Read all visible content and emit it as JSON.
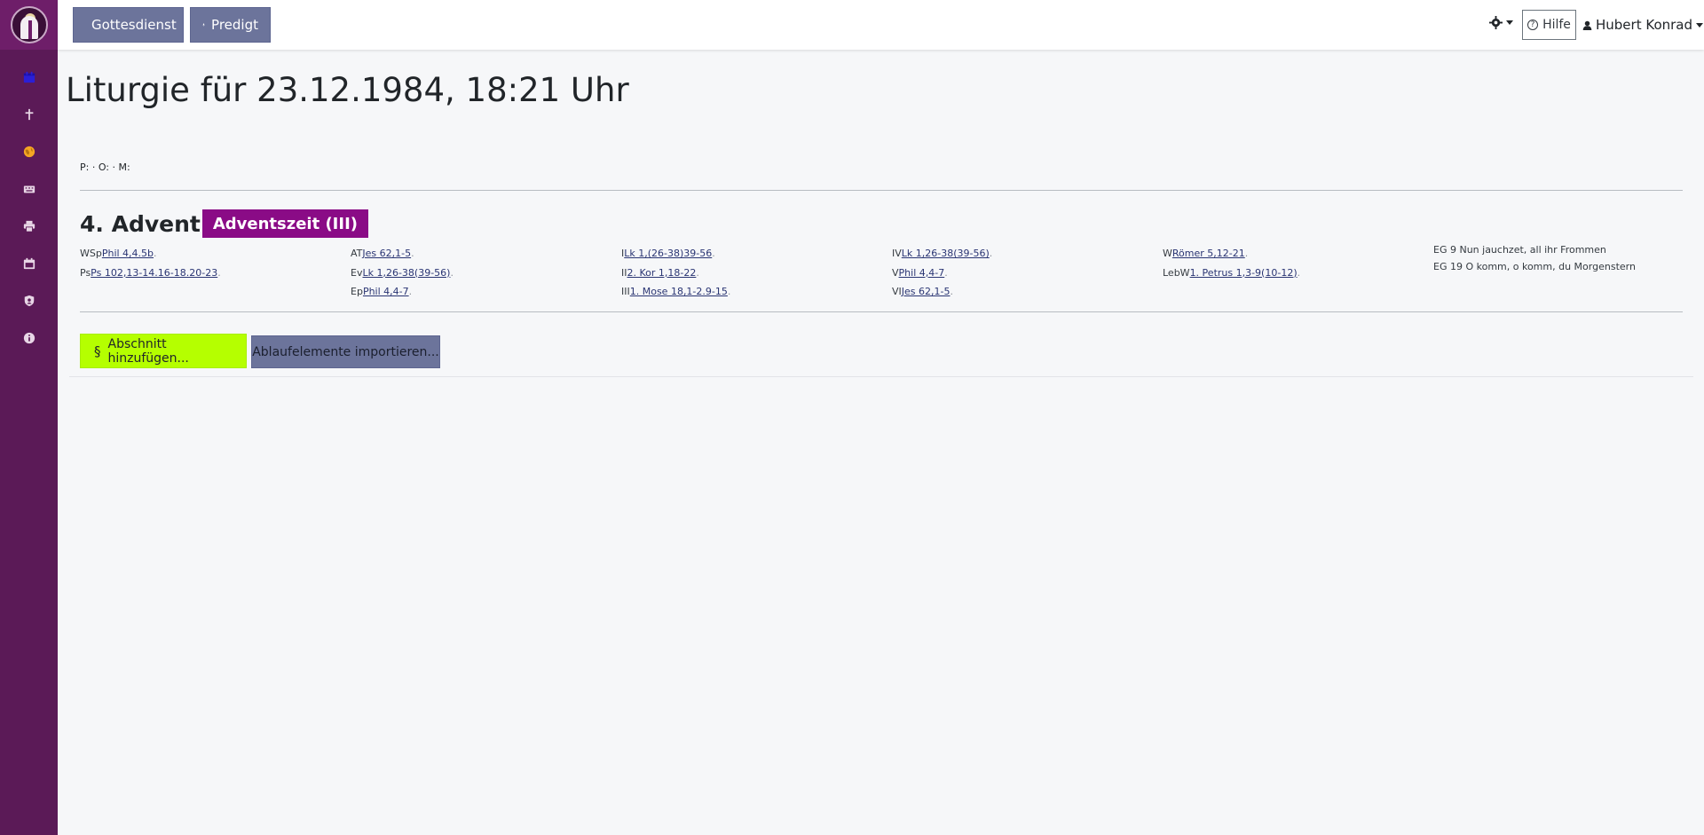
{
  "topbar": {
    "buttons": [
      "Gottesdienst",
      "Predigt"
    ],
    "help_label": "Hilfe",
    "help_icon_glyph": "?",
    "user_name": "Hubert Konrad"
  },
  "sidebar": {
    "items": [
      "calendar-icon",
      "cross-icon",
      "globe-icon",
      "keyboard-icon",
      "printer-icon",
      "calendar-alt-icon",
      "user-shield-icon",
      "info-icon"
    ]
  },
  "page": {
    "title": "Liturgie für 23.12.1984, 18:21 Uhr",
    "team_line": "P: · O: · M:"
  },
  "day": {
    "name": "4. Advent",
    "period": "Adventszeit (III)"
  },
  "readings": {
    "col1": [
      {
        "label": "WSp",
        "ref": "Phil 4,4.5b"
      },
      {
        "label": "Ps",
        "ref": "Ps 102,13-14.16-18.20-23"
      }
    ],
    "col2": [
      {
        "label": "AT",
        "ref": "Jes 62,1-5"
      },
      {
        "label": "Ev",
        "ref": "Lk 1,26-38(39-56)"
      },
      {
        "label": "Ep",
        "ref": "Phil 4,4-7"
      }
    ],
    "col3": [
      {
        "label": "I",
        "ref": "Lk 1,(26-38)39-56"
      },
      {
        "label": "II",
        "ref": "2. Kor 1,18-22"
      },
      {
        "label": "III",
        "ref": "1. Mose 18,1-2.9-15"
      }
    ],
    "col4": [
      {
        "label": "IV",
        "ref": "Lk 1,26-38(39-56)"
      },
      {
        "label": "V",
        "ref": "Phil 4,4-7"
      },
      {
        "label": "VI",
        "ref": "Jes 62,1-5"
      }
    ],
    "col5": [
      {
        "label": "W",
        "ref": "Römer 5,12-21"
      },
      {
        "label": "LebW",
        "ref": "1. Petrus 1,3-9(10-12)"
      }
    ],
    "songs": [
      "EG 9 Nun jauchzet, all ihr Frommen",
      "EG 19 O komm, o komm, du Morgenstern"
    ]
  },
  "actions": {
    "add_section_symbol": "§",
    "add_section": "Abschnitt hinzufügen...",
    "import": "Ablaufelemente importieren..."
  },
  "colors": {
    "sidebar": "#5b1a57",
    "accent_purple": "#8a0b86",
    "button_slate": "#6c749b",
    "button_lime": "#b5ff00",
    "link": "#2a3573"
  }
}
